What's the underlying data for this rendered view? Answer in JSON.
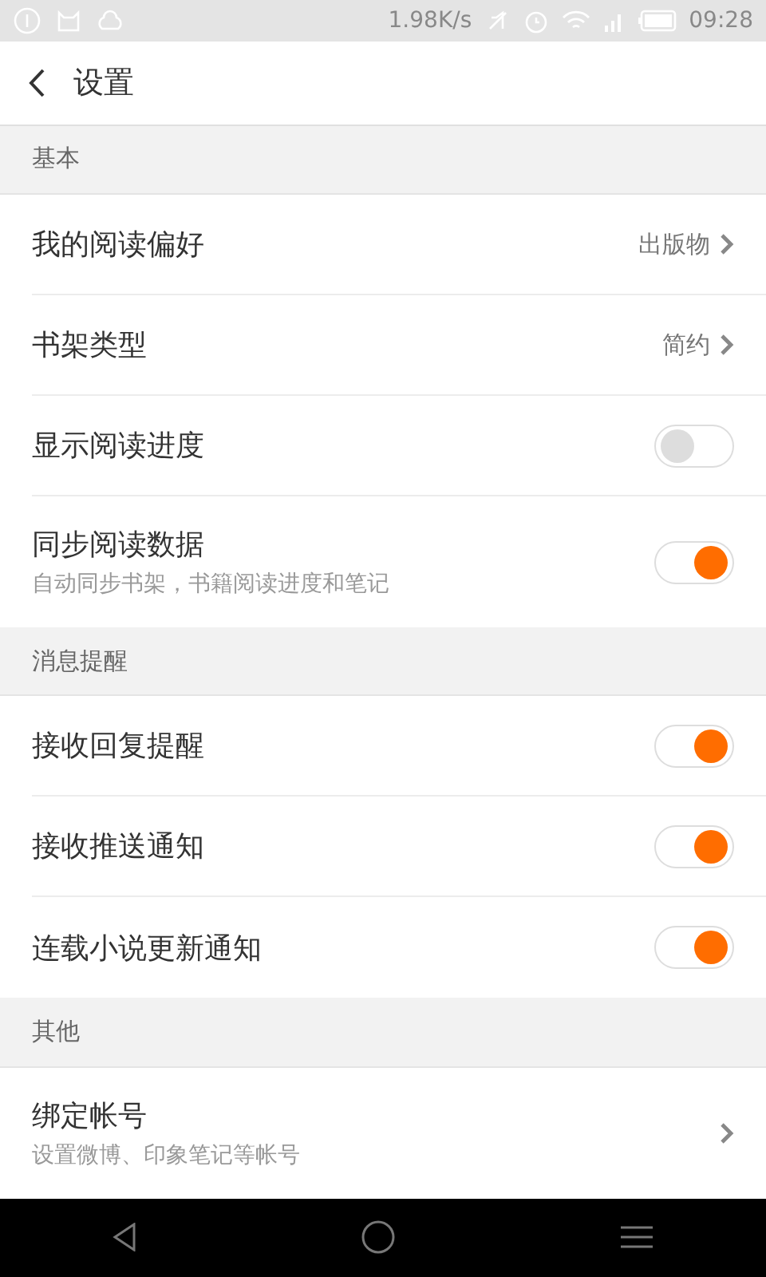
{
  "status_bar": {
    "speed": "1.98K/s",
    "time": "09:28"
  },
  "header": {
    "title": "设置"
  },
  "sections": [
    {
      "title": "基本",
      "items": [
        {
          "kind": "link",
          "label": "我的阅读偏好",
          "value": "出版物"
        },
        {
          "kind": "link",
          "label": "书架类型",
          "value": "简约"
        },
        {
          "kind": "toggle",
          "label": "显示阅读进度",
          "on": false
        },
        {
          "kind": "toggle",
          "label": "同步阅读数据",
          "subtitle": "自动同步书架，书籍阅读进度和笔记",
          "on": true
        }
      ]
    },
    {
      "title": "消息提醒",
      "items": [
        {
          "kind": "toggle",
          "label": "接收回复提醒",
          "on": true
        },
        {
          "kind": "toggle",
          "label": "接收推送通知",
          "on": true
        },
        {
          "kind": "toggle",
          "label": "连载小说更新通知",
          "on": true
        }
      ]
    },
    {
      "title": "其他",
      "items": [
        {
          "kind": "link",
          "label": "绑定帐号",
          "subtitle": "设置微博、印象笔记等帐号"
        }
      ]
    }
  ]
}
